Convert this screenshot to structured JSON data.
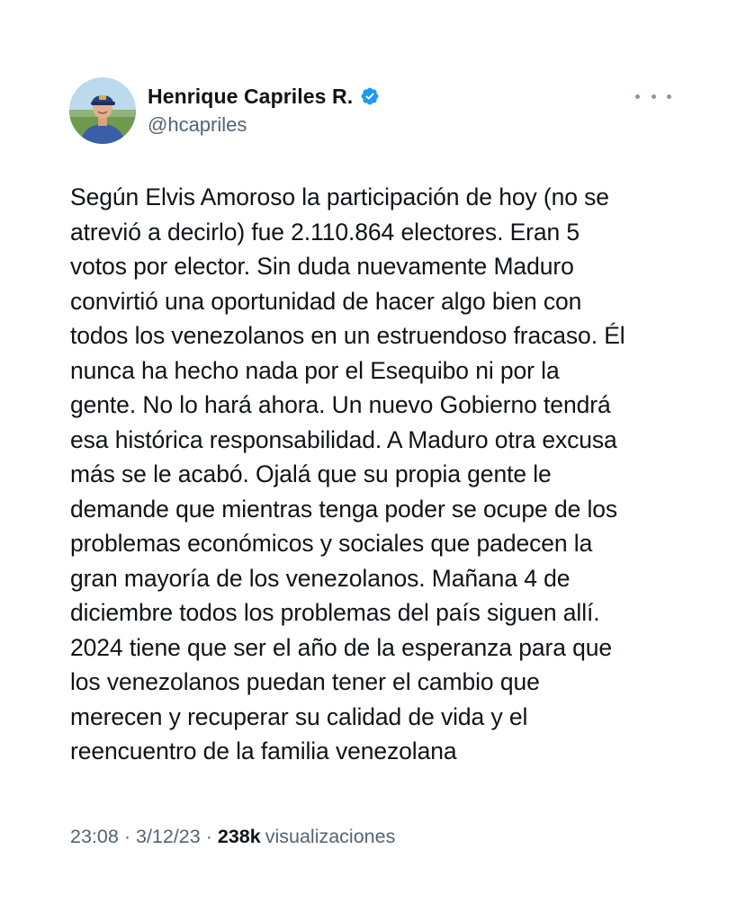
{
  "author": {
    "display_name": "Henrique Capriles R.",
    "handle": "@hcapriles",
    "verified": true,
    "verified_color": "#1d9bf0"
  },
  "menu": {
    "icon": "more-horizontal-icon"
  },
  "tweet": {
    "text": "Según Elvis Amoroso la participación de hoy (no se\natrevió a decirlo) fue 2.110.864 electores. Eran 5\nvotos por elector. Sin duda nuevamente Maduro\nconvirtió una oportunidad de hacer algo bien con\ntodos los venezolanos en un estruendoso fracaso. Él\nnunca ha hecho nada por el Esequibo ni por la\ngente. No lo hará ahora. Un nuevo Gobierno tendrá\nesa histórica responsabilidad. A Maduro otra excusa\nmás se le acabó. Ojalá que su propia gente le\ndemande que mientras tenga poder se ocupe de los\nproblemas económicos y sociales que padecen la\ngran mayoría de los venezolanos. Mañana 4 de\ndiciembre todos los problemas del país siguen allí.\n2024 tiene que ser el año de la esperanza para que\nlos venezolanos puedan tener el cambio que\nmerecen y recuperar su calidad de vida y el\nreencuentro de la familia venezolana"
  },
  "meta": {
    "time": "23:08",
    "separator": "·",
    "date": "3/12/23",
    "views_count": "238k",
    "views_label": "visualizaciones"
  }
}
